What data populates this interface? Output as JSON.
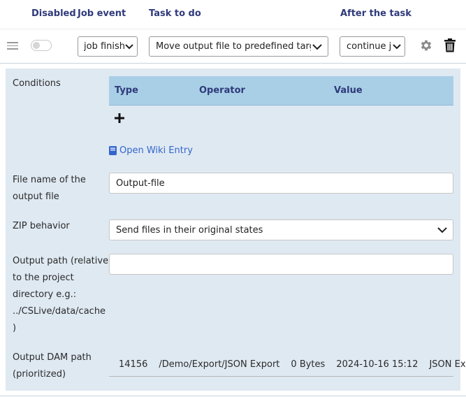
{
  "header": {
    "disabled": "Disabled",
    "job_event": "Job event",
    "task_to_do": "Task to do",
    "after_the_task": "After the task"
  },
  "row": {
    "job_event_value": "job finished",
    "task_value": "Move output file to predefined target",
    "after_value": "continue job",
    "disabled_toggle": false
  },
  "conditions": {
    "label": "Conditions",
    "columns": [
      "Type",
      "Operator",
      "Value"
    ],
    "add_icon": "plus-icon",
    "wiki_link": "Open Wiki Entry"
  },
  "file_name": {
    "label_line1": "File name of the",
    "label_line2": "output file",
    "value": "Output-file"
  },
  "zip": {
    "label": "ZIP behavior",
    "value": "Send files in their original states"
  },
  "output_path": {
    "label_lines": [
      "Output path (relative",
      "to the project",
      "directory e.g.:",
      "../CSLive/data/cache",
      ")"
    ],
    "value": ""
  },
  "dam": {
    "label_line1": "Output DAM path",
    "label_line2": "(prioritized)",
    "id": "14156",
    "path": "/Demo/Export/JSON Export",
    "size": "0 Bytes",
    "date": "2024-10-16 15:12",
    "name": "JSON Export"
  },
  "colors": {
    "header_text": "#2f3a7a",
    "panel_bg": "#dfe9f2",
    "table_head_bg": "#a9cfe6",
    "link": "#3366cc"
  }
}
